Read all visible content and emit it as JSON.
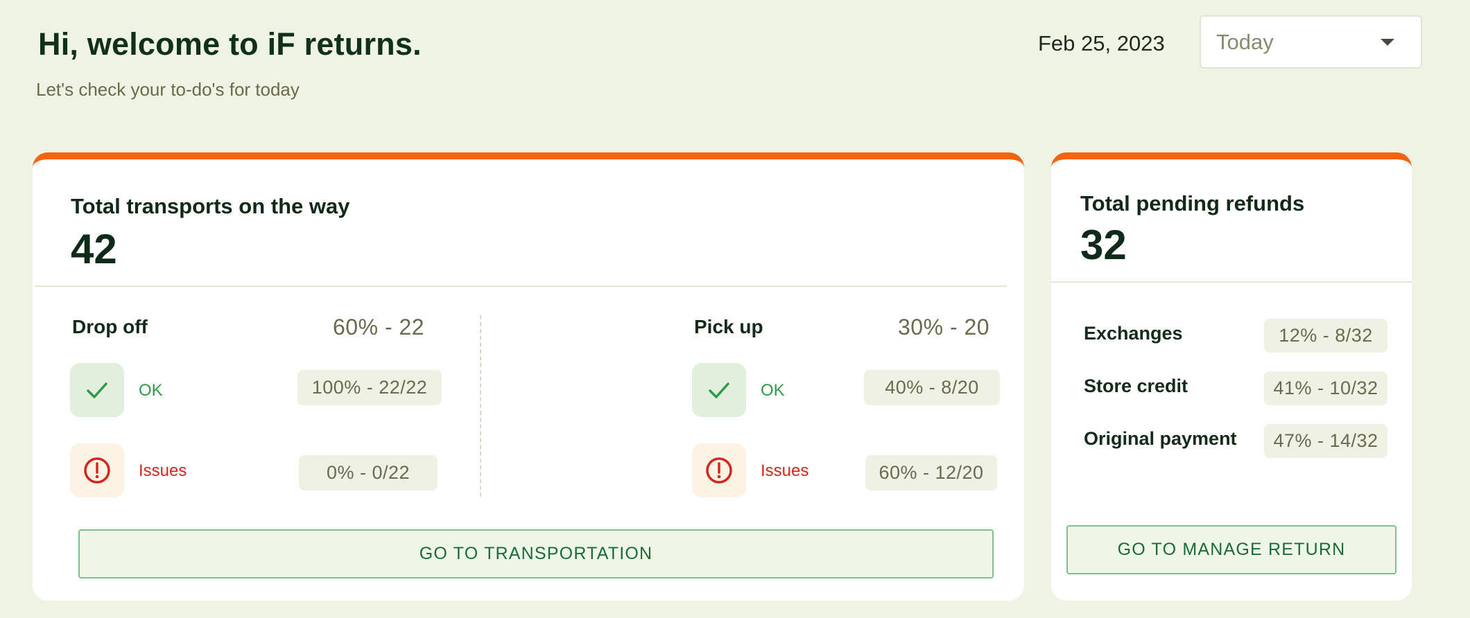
{
  "header": {
    "greeting": "Hi, welcome to iF returns.",
    "subtitle": "Let's check your to-do's for today",
    "date": "Feb 25, 2023",
    "period_select": {
      "value": "Today"
    }
  },
  "colors": {
    "accent": "#f26411",
    "ok": "#2e9a4a",
    "issue": "#d6251c",
    "background": "#eef3e3"
  },
  "transports": {
    "title": "Total transports on the way",
    "total": "42",
    "drop_off": {
      "label": "Drop off",
      "stat": "60% -  22",
      "ok_label": "OK",
      "ok_value": "100% - 22/22",
      "issues_label": "Issues",
      "issues_value": "0% - 0/22"
    },
    "pick_up": {
      "label": "Pick up",
      "stat": "30% - 20",
      "ok_label": "OK",
      "ok_value": "40% - 8/20",
      "issues_label": "Issues",
      "issues_value": "60% - 12/20"
    },
    "cta": "GO TO TRANSPORTATION"
  },
  "refunds": {
    "title": "Total pending refunds",
    "total": "32",
    "rows": [
      {
        "label": "Exchanges",
        "value": "12% -  8/32"
      },
      {
        "label": "Store credit",
        "value": "41%  - 10/32"
      },
      {
        "label": "Original payment",
        "value": "47% -  14/32"
      }
    ],
    "cta": "GO TO  MANAGE RETURN"
  },
  "icons": {
    "ok": "checkmark-icon",
    "issue": "exclamation-circle-icon",
    "dropdown": "chevron-down-icon"
  }
}
